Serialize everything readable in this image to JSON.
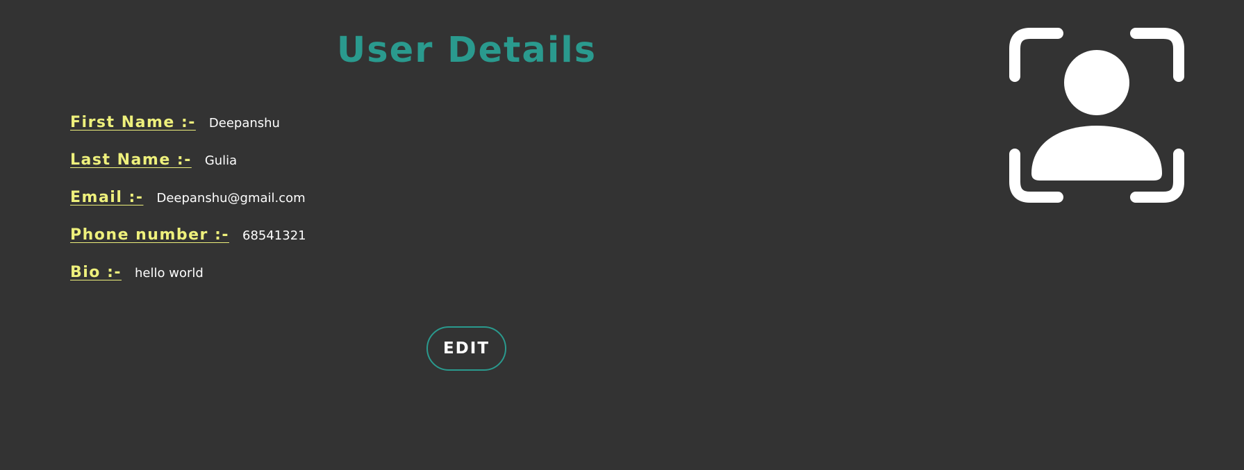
{
  "page": {
    "title": "User Details",
    "colors": {
      "background": "#333333",
      "accent": "#2a9a8e",
      "label": "#eef07c",
      "value": "#ffffff"
    }
  },
  "details": [
    {
      "label": "First Name :-",
      "value": "Deepanshu"
    },
    {
      "label": "Last Name :-",
      "value": "Gulia"
    },
    {
      "label": "Email :-",
      "value": "Deepanshu@gmail.com"
    },
    {
      "label": "Phone number :-",
      "value": "68541321"
    },
    {
      "label": "Bio :-",
      "value": "hello world"
    }
  ],
  "actions": {
    "edit_label": "EDIT"
  },
  "icons": {
    "profile": "user-scan-icon"
  }
}
